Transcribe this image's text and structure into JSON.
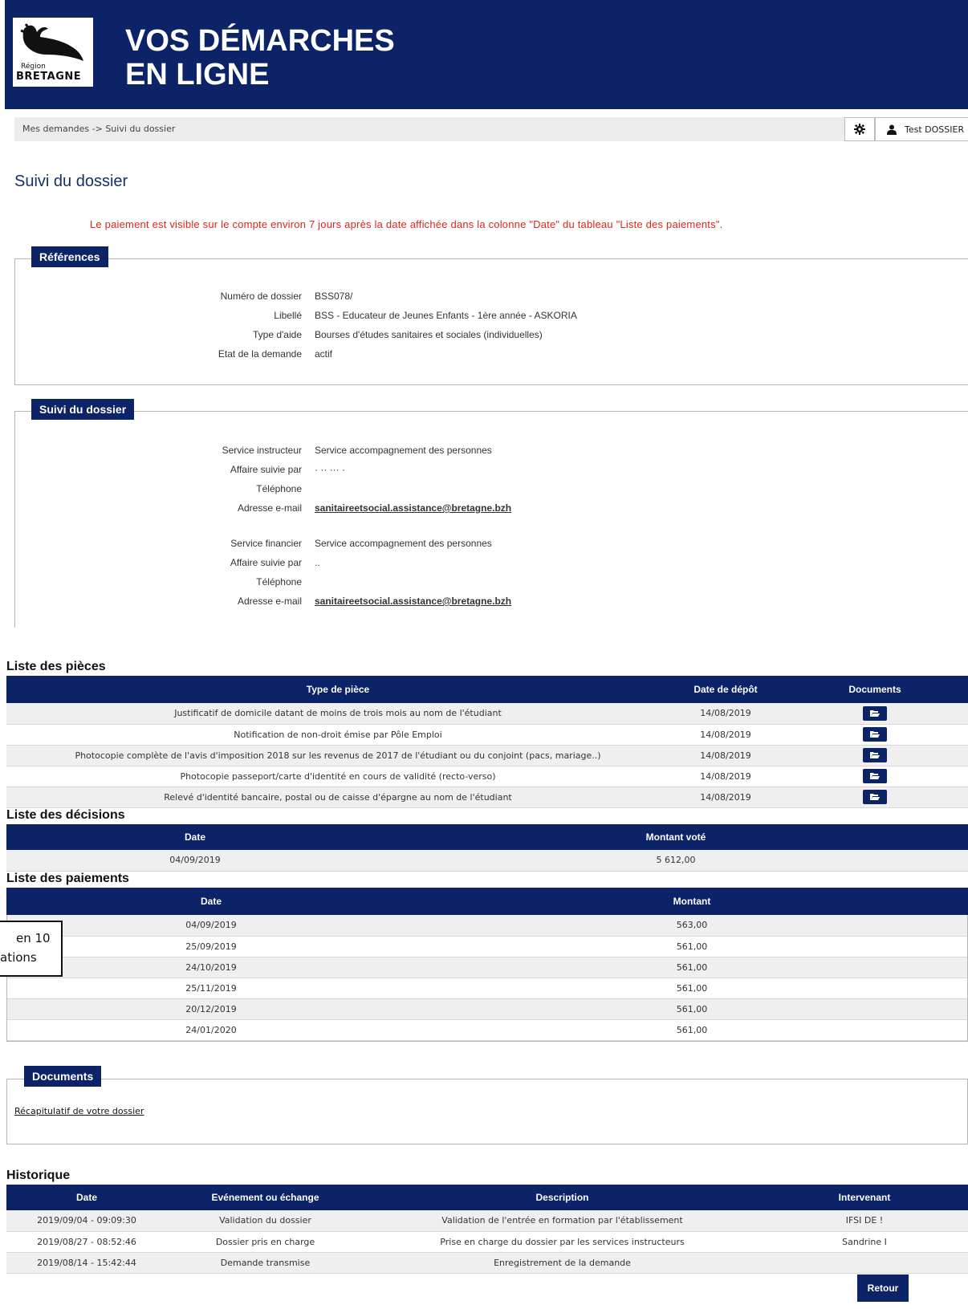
{
  "header": {
    "logo_small": "Région",
    "logo_big": "BRETAGNE",
    "title_line1": "VOS DÉMARCHES",
    "title_line2": "EN LIGNE"
  },
  "breadcrumb": "Mes demandes -> Suivi du dossier",
  "user": {
    "name": "Test DOSSIER"
  },
  "page_title": "Suivi du dossier",
  "notice": "Le paiement est visible sur le compte environ 7 jours après la date affichée dans la colonne \"Date\" du tableau \"Liste des paiements\".",
  "references": {
    "legend": "Références",
    "rows": [
      {
        "label": "Numéro de dossier",
        "value": "BSS078/"
      },
      {
        "label": "Libellé",
        "value": "BSS - Educateur de Jeunes Enfants - 1ère année - ASKORIA"
      },
      {
        "label": "Type d'aide",
        "value": "Bourses d'études sanitaires et sociales (individuelles)"
      },
      {
        "label": "Etat de la demande",
        "value": "actif"
      }
    ]
  },
  "suivi": {
    "legend": "Suivi du dossier",
    "instructeur": [
      {
        "label": "Service instructeur",
        "value": "Service accompagnement des personnes"
      },
      {
        "label": "Affaire suivie par",
        "value": "· ·· ···  ·"
      },
      {
        "label": "Téléphone",
        "value": ""
      },
      {
        "label": "Adresse e-mail",
        "value": "sanitaireetsocial.assistance@bretagne.bzh"
      }
    ],
    "financier": [
      {
        "label": "Service financier",
        "value": "Service accompagnement des personnes"
      },
      {
        "label": "Affaire suivie par",
        "value": "                 .."
      },
      {
        "label": "Téléphone",
        "value": ""
      },
      {
        "label": "Adresse e-mail",
        "value": "sanitaireetsocial.assistance@bretagne.bzh"
      }
    ]
  },
  "pieces": {
    "title": "Liste des pièces",
    "headers": [
      "Type de pièce",
      "Date de dépôt",
      "Documents"
    ],
    "rows": [
      [
        "Justificatif de domicile datant de moins de trois mois au nom de l'étudiant",
        "14/08/2019"
      ],
      [
        "Notification de non-droit émise par Pôle Emploi",
        "14/08/2019"
      ],
      [
        "Photocopie complète de l'avis d'imposition 2018 sur les revenus de 2017 de l'étudiant ou du conjoint (pacs, mariage..)",
        "14/08/2019"
      ],
      [
        "Photocopie passeport/carte d'identité en cours de validité (recto-verso)",
        "14/08/2019"
      ],
      [
        "Relevé d'identité bancaire, postal ou de caisse d'épargne au nom de l'étudiant",
        "14/08/2019"
      ]
    ]
  },
  "decisions": {
    "title": "Liste des décisions",
    "headers": [
      "Date",
      "Montant voté"
    ],
    "rows": [
      [
        "04/09/2019",
        "5 612,00"
      ]
    ]
  },
  "paiements": {
    "title": "Liste des paiements",
    "headers": [
      "Date",
      "Montant"
    ],
    "rows": [
      [
        "04/09/2019",
        "563,00"
      ],
      [
        "25/09/2019",
        "561,00"
      ],
      [
        "24/10/2019",
        "561,00"
      ],
      [
        "25/11/2019",
        "561,00"
      ],
      [
        "20/12/2019",
        "561,00"
      ],
      [
        "24/01/2020",
        "561,00"
      ]
    ]
  },
  "callout": {
    "line1": "en 10",
    "line2": "ations"
  },
  "documents": {
    "legend": "Documents",
    "link": "Récapitulatif de votre dossier"
  },
  "historique": {
    "title": "Historique",
    "headers": [
      "Date",
      "Evénement ou échange",
      "Description",
      "Intervenant"
    ],
    "rows": [
      [
        "2019/09/04 - 09:09:30",
        "Validation du dossier",
        "Validation de l'entrée en formation par l'établissement",
        "IFSI DE !"
      ],
      [
        "2019/08/27 - 08:52:46",
        "Dossier pris en charge",
        "Prise en charge du dossier par les services instructeurs",
        "Sandrine I"
      ],
      [
        "2019/08/14 - 15:42:44",
        "Demande transmise",
        "Enregistrement de la demande",
        ""
      ]
    ]
  },
  "retour": "Retour",
  "colors": {
    "navy": "#0c2367",
    "red": "#e0251b"
  }
}
